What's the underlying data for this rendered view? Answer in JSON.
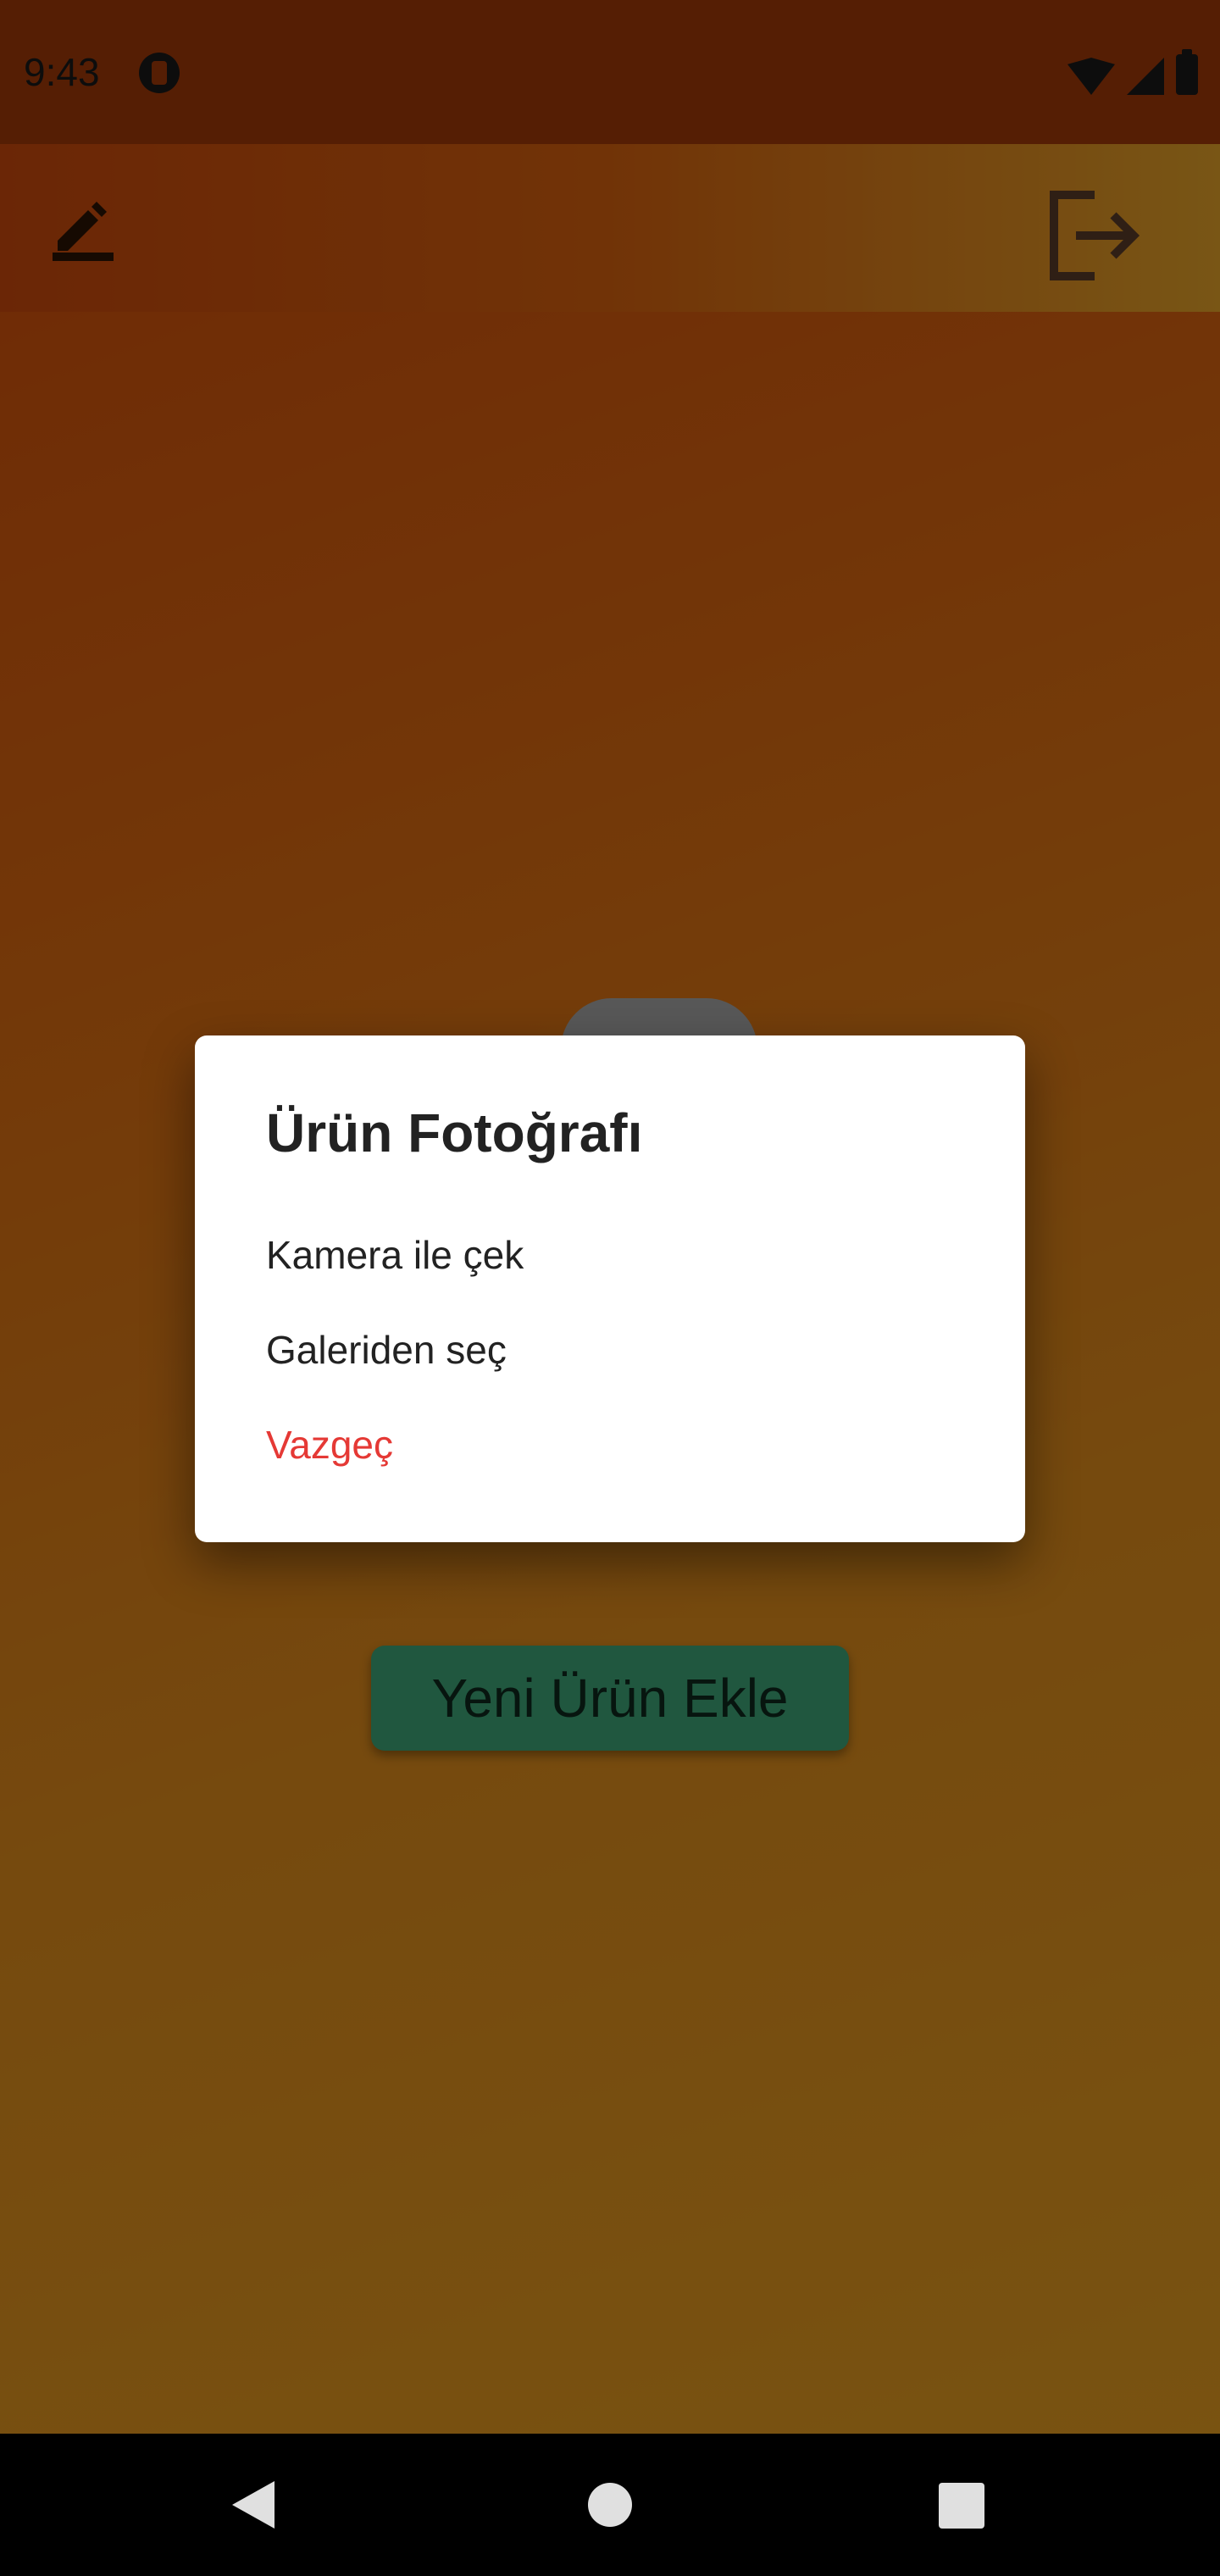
{
  "status_bar": {
    "time": "9:43",
    "icons": [
      "app-notification-icon",
      "wifi-icon",
      "signal-icon",
      "battery-icon"
    ]
  },
  "app_bar": {
    "left_icon": "edit-icon",
    "right_icon": "logout-icon"
  },
  "main": {
    "add_product_label": "Yeni Ürün Ekle"
  },
  "dialog": {
    "title": "Ürün Fotoğrafı",
    "options": [
      {
        "label": "Kamera ile çek"
      },
      {
        "label": "Galeriden seç"
      },
      {
        "label": "Vazgeç",
        "color": "#e53935"
      }
    ]
  },
  "nav_bar": {
    "icons": [
      "back-icon",
      "home-icon",
      "recents-icon"
    ]
  },
  "colors": {
    "accent_button": "#3fa779",
    "cancel_text": "#e53935",
    "background_start": "#d24a0a",
    "background_end": "#e89f22"
  }
}
